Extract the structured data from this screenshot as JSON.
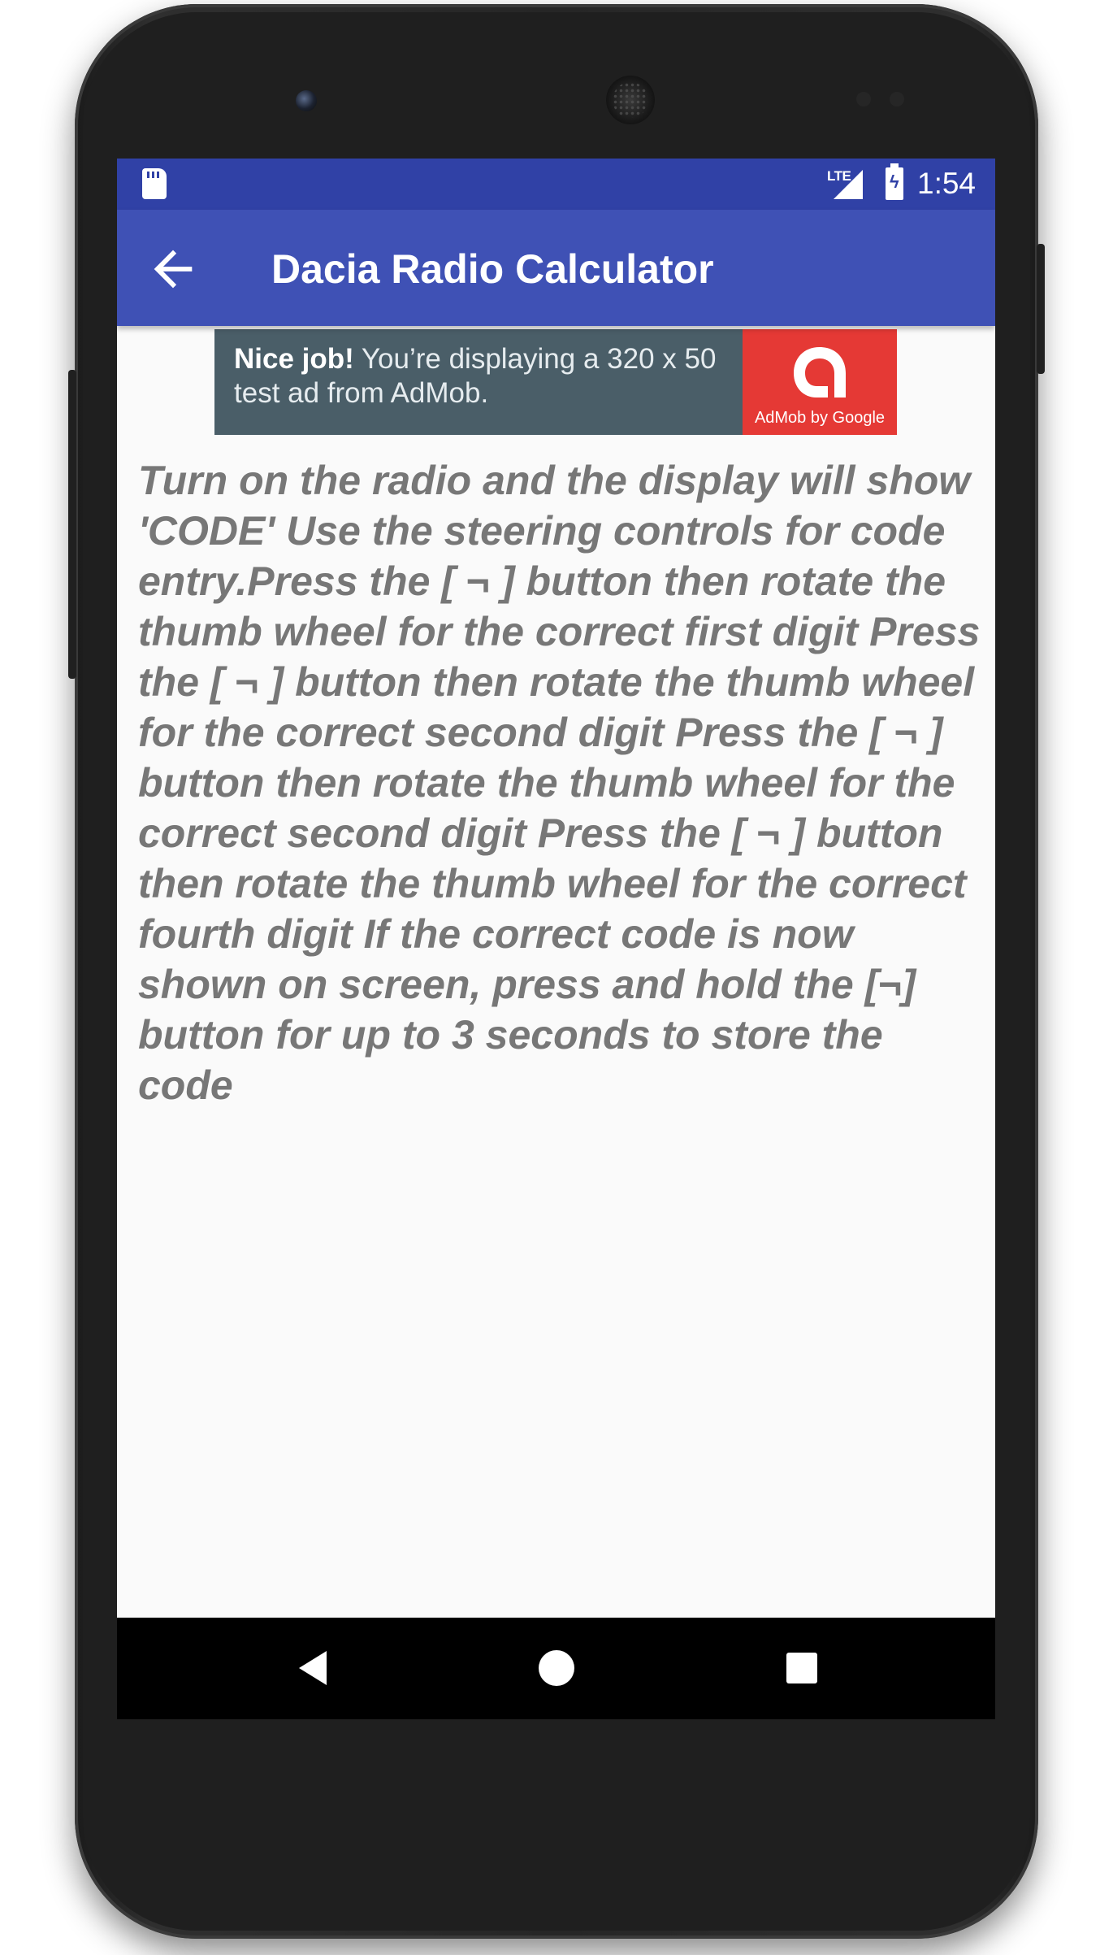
{
  "status_bar": {
    "network": "LTE",
    "time": "1:54"
  },
  "app_bar": {
    "title": "Dacia Radio Calculator"
  },
  "ad": {
    "headline": "Nice job!",
    "text": " You’re displaying a 320 x 50 test ad from AdMob.",
    "logo_caption": "AdMob by Google"
  },
  "content": {
    "instructions": "Turn on the radio and the display will show 'CODE' Use the steering controls for code entry.Press the [ ¬ ] button then rotate the thumb wheel for the correct first digit Press the [ ¬ ] button then rotate the thumb wheel for the correct second digit Press the [ ¬ ] button then rotate the thumb wheel for the correct second digit Press the [ ¬ ] button then rotate the thumb wheel for the correct fourth digit If the correct code is now shown on screen, press and hold the [¬] button for up to 3 seconds to store the code"
  },
  "icons": {
    "status_left": "sd-card-icon",
    "signal": "signal-icon",
    "battery": "battery-charging-icon",
    "back": "arrow-back-icon",
    "nav_back": "triangle-back-icon",
    "nav_home": "circle-home-icon",
    "nav_recents": "square-recents-icon"
  },
  "colors": {
    "status_bar": "#3041a6",
    "app_bar": "#3f51b5",
    "ad_background": "#4a5e68",
    "ad_logo": "#e53935",
    "body_text": "#777777",
    "screen_background": "#fafafa"
  }
}
